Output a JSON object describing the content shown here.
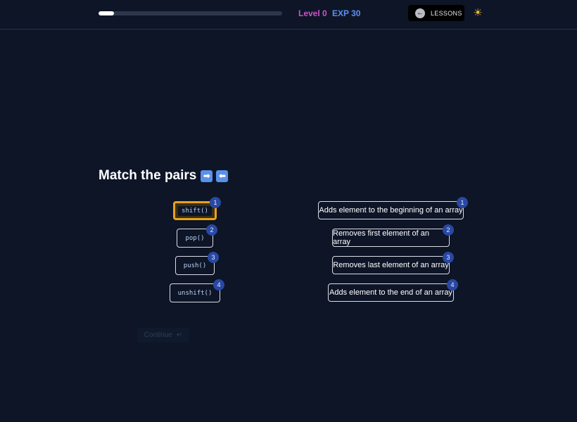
{
  "header": {
    "progress": 0.085,
    "level_label": "Level 0",
    "exp_label": "EXP 30",
    "lessons_label": "LESSONS",
    "back_icon": "arrow-left-circle-icon",
    "theme_icon": "sun-icon"
  },
  "title": {
    "text": "Match the pairs",
    "emoji_right": "➡",
    "emoji_left": "⬅"
  },
  "left_items": [
    {
      "label": "shift()",
      "badge": "1",
      "selected": true
    },
    {
      "label": "pop()",
      "badge": "2",
      "selected": false
    },
    {
      "label": "push()",
      "badge": "3",
      "selected": false
    },
    {
      "label": "unshift()",
      "badge": "4",
      "selected": false
    }
  ],
  "right_items": [
    {
      "label": "Adds element to the beginning of an array",
      "badge": "1"
    },
    {
      "label": "Removes first element of an array",
      "badge": "2"
    },
    {
      "label": "Removes last element of an array",
      "badge": "3"
    },
    {
      "label": "Adds element to the end of an array",
      "badge": "4"
    }
  ],
  "continue": {
    "label": "Continue",
    "enter_glyph": "↵",
    "disabled": true
  },
  "colors": {
    "background": "#0d1527",
    "level": "#d151c8",
    "exp": "#5c8ff0",
    "selected_border": "#e9a21b",
    "badge": "#2948a3"
  }
}
